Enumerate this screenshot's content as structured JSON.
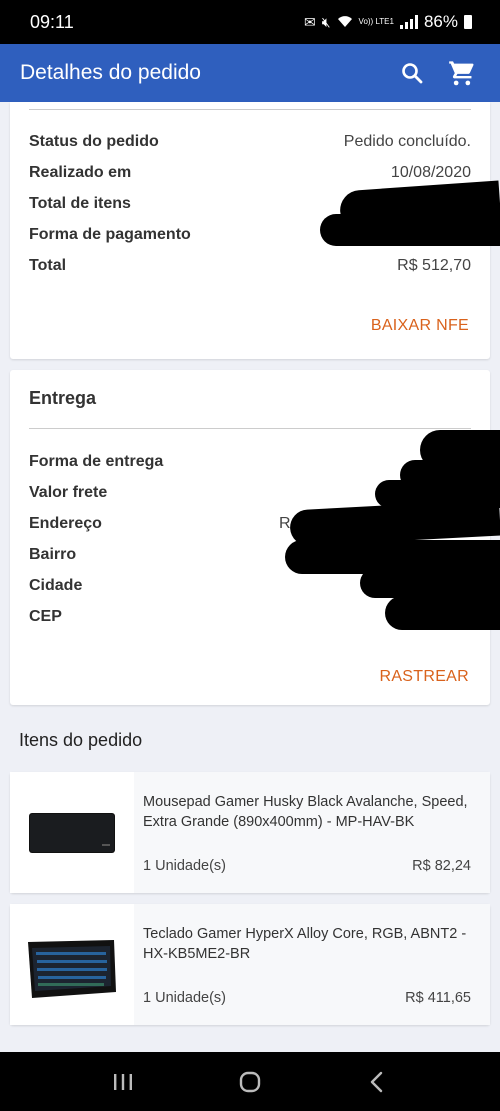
{
  "status_bar": {
    "time": "09:11",
    "lte_label": "Vo)) LTE1",
    "battery": "86%"
  },
  "app_bar": {
    "title": "Detalhes do pedido",
    "icons": [
      "search-icon",
      "cart-icon"
    ],
    "color": "#2f5fbe"
  },
  "order_summary": {
    "rows": [
      {
        "label": "Status do pedido",
        "value": "Pedido concluído."
      },
      {
        "label": "Realizado em",
        "value": "10/08/2020"
      },
      {
        "label": "Total de itens",
        "value": ""
      },
      {
        "label": "Forma de pagamento",
        "value": ""
      },
      {
        "label": "Total",
        "value": "R$ 512,70"
      }
    ],
    "download_button": "BAIXAR NFE"
  },
  "delivery": {
    "title": "Entrega",
    "rows": [
      {
        "label": "Forma de entrega",
        "value": ""
      },
      {
        "label": "Valor frete",
        "value": ""
      },
      {
        "label": "Endereço",
        "value": "R"
      },
      {
        "label": "Bairro",
        "value": ""
      },
      {
        "label": "Cidade",
        "value": ""
      },
      {
        "label": "CEP",
        "value": ""
      }
    ],
    "track_button": "RASTREAR"
  },
  "items_section": {
    "title": "Itens do pedido",
    "items": [
      {
        "name": "Mousepad Gamer Husky Black Avalanche, Speed, Extra Grande (890x400mm) - MP-HAV-BK",
        "quantity": "1 Unidade(s)",
        "price": "R$ 82,24"
      },
      {
        "name": "Teclado Gamer HyperX Alloy Core, RGB, ABNT2 - HX-KB5ME2-BR",
        "quantity": "1 Unidade(s)",
        "price": "R$ 411,65"
      }
    ]
  },
  "colors": {
    "accent": "#d9621c",
    "background": "#eef0f6"
  }
}
